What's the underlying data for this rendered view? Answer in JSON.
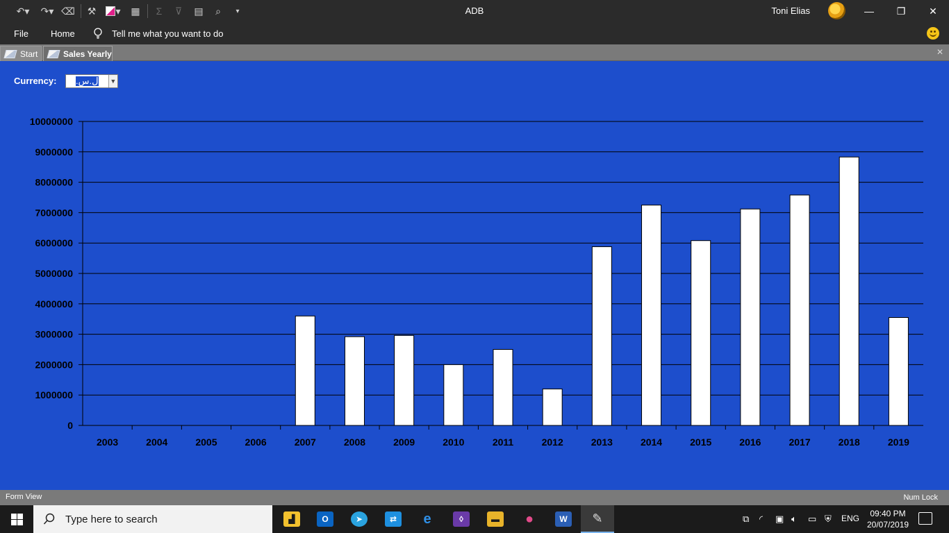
{
  "window": {
    "title": "ADB",
    "user_name": "Toni Elias"
  },
  "ribbon": {
    "tabs": [
      "File",
      "Home"
    ],
    "tell_me": "Tell me what you want to do"
  },
  "doc_tabs": [
    {
      "label": "Start",
      "active": false
    },
    {
      "label": "Sales Yearly",
      "active": true
    }
  ],
  "form": {
    "currency_label": "Currency:",
    "currency_value": "ل.س."
  },
  "chart_data": {
    "type": "bar",
    "categories": [
      "2003",
      "2004",
      "2005",
      "2006",
      "2007",
      "2008",
      "2009",
      "2010",
      "2011",
      "2012",
      "2013",
      "2014",
      "2015",
      "2016",
      "2017",
      "2018",
      "2019"
    ],
    "values": [
      0,
      0,
      0,
      0,
      3600000,
      2920000,
      2960000,
      2000000,
      2500000,
      1200000,
      5880000,
      7250000,
      6080000,
      7120000,
      7580000,
      8830000,
      3550000
    ],
    "ylim": [
      0,
      10000000
    ],
    "yticks": [
      0,
      1000000,
      2000000,
      3000000,
      4000000,
      5000000,
      6000000,
      7000000,
      8000000,
      9000000,
      10000000
    ],
    "grid": true,
    "colors": {
      "background": "#1d4ecc",
      "bar": "#ffffff",
      "bar_border": "#000000",
      "grid": "#000000"
    }
  },
  "status": {
    "left": "Form View",
    "right": "Num Lock"
  },
  "taskbar": {
    "search_placeholder": "Type here to search",
    "apps": [
      "file-explorer-pinned-icon",
      "outlook-icon",
      "telegram-icon",
      "remote-desktop-icon",
      "edge-icon",
      "visual-studio-icon",
      "folder-icon",
      "maps-icon",
      "word-icon",
      "access-app-icon"
    ],
    "language": "ENG",
    "time": "09:40 PM",
    "date": "20/07/2019"
  }
}
